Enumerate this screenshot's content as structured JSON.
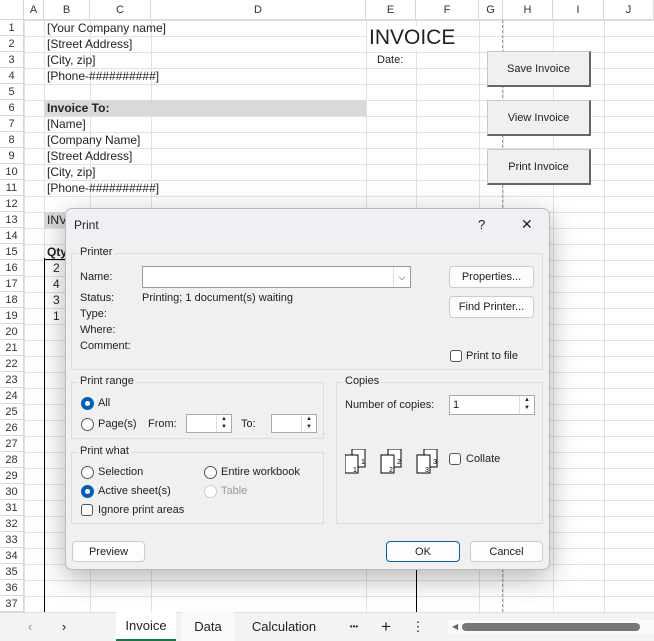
{
  "columns": [
    "A",
    "B",
    "C",
    "D",
    "E",
    "F",
    "G",
    "H",
    "I",
    "J"
  ],
  "cells": {
    "b1": "[Your Company name]",
    "b2": "[Street Address]",
    "b3": "[City, zip]",
    "b4": "[Phone-##########]",
    "b6": "Invoice To:",
    "b7": "[Name]",
    "b8": "[Company Name]",
    "b9": "[Street Address]",
    "b10": "[City, zip]",
    "b11": "[Phone-##########]",
    "b13": "INV",
    "b15": "Qty",
    "q16": "2",
    "q17": "4",
    "q18": "3",
    "q19": "1",
    "title": "INVOICE",
    "date": "Date:"
  },
  "buttons": {
    "save": "Save Invoice",
    "view": "View Invoice",
    "print": "Print Invoice"
  },
  "dialog": {
    "title": "Print",
    "help": "?",
    "close": "✕",
    "printer": {
      "group": "Printer",
      "name_label": "Name:",
      "name_value": "",
      "status_label": "Status:",
      "status_value": "Printing; 1 document(s) waiting",
      "type_label": "Type:",
      "where_label": "Where:",
      "comment_label": "Comment:",
      "properties": "Properties...",
      "find": "Find Printer...",
      "print_to_file": "Print to file",
      "print_to_file_checked": false
    },
    "range": {
      "group": "Print range",
      "all": "All",
      "pages": "Page(s)",
      "from": "From:",
      "to": "To:",
      "selected": "All"
    },
    "what": {
      "group": "Print what",
      "selection": "Selection",
      "entire": "Entire workbook",
      "active": "Active sheet(s)",
      "table": "Table",
      "ignore": "Ignore print areas",
      "selected": "Active sheet(s)"
    },
    "copies": {
      "group": "Copies",
      "number_label": "Number of copies:",
      "number_value": "1",
      "collate": "Collate",
      "collate_checked": false
    },
    "preview": "Preview",
    "ok": "OK",
    "cancel": "Cancel"
  },
  "sheet_tabs": [
    "Invoice",
    "Data",
    "Calculation"
  ],
  "active_tab": "Invoice",
  "tab_more": "•••",
  "tab_add": "+",
  "tab_menu": "⋮"
}
